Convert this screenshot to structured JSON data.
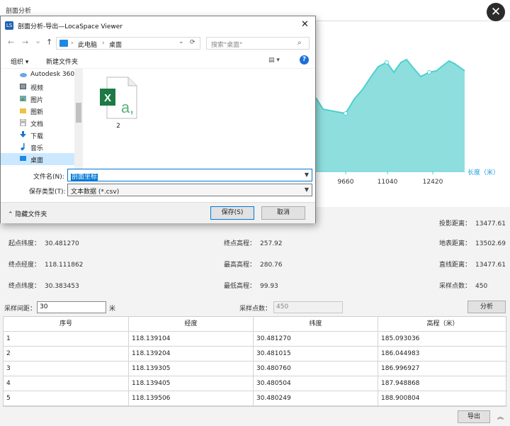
{
  "outer": {
    "title": "剖面分析",
    "close_glyph": "✕"
  },
  "chart_data": {
    "type": "area",
    "x_tick_labels": [
      "9660",
      "11040",
      "12420"
    ],
    "xlabel": "长度（米）",
    "color": "#4fcfcf",
    "fill": "#8fdede"
  },
  "stats": {
    "row1": {
      "proj_dist_label": "投影距离：",
      "proj_dist_value": "13477.61"
    },
    "row2": {
      "start_lat_label": "起点纬度：",
      "start_lat_value": "30.481270",
      "end_elev_label": "终点高程：",
      "end_elev_value": "257.92",
      "surface_dist_label": "地表距离：",
      "surface_dist_value": "13502.69"
    },
    "row3": {
      "end_lon_label": "终点经度：",
      "end_lon_value": "118.111862",
      "max_elev_label": "最高高程：",
      "max_elev_value": "280.76",
      "straight_dist_label": "直线距离：",
      "straight_dist_value": "13477.61"
    },
    "row4": {
      "end_lat_label": "终点纬度：",
      "end_lat_value": "30.383453",
      "min_elev_label": "最低高程：",
      "min_elev_value": "99.93",
      "sample_count_label": "采样点数：",
      "sample_count_value": "450"
    }
  },
  "controls": {
    "interval_label": "采样间距：",
    "interval_value": "30",
    "interval_unit": "米",
    "points_label": "采样点数：",
    "points_value": "450",
    "analyze_label": "分析"
  },
  "table": {
    "headers": [
      "序号",
      "经度",
      "纬度",
      "高程（米）"
    ],
    "rows": [
      [
        "1",
        "118.139104",
        "30.481270",
        "185.093036"
      ],
      [
        "2",
        "118.139204",
        "30.481015",
        "186.044983"
      ],
      [
        "3",
        "118.139305",
        "30.480760",
        "186.996927"
      ],
      [
        "4",
        "118.139405",
        "30.480504",
        "187.948868"
      ],
      [
        "5",
        "118.139506",
        "30.480249",
        "188.900804"
      ]
    ]
  },
  "bottom": {
    "export_label": "导出",
    "collapse_glyph": "︽"
  },
  "dialog": {
    "title": "剖面分析-导出—LocaSpace Viewer",
    "app_icon": "LS",
    "close_glyph": "✕",
    "nav": {
      "back": "←",
      "forward": "→",
      "dropdown": "⌄",
      "up": "↑",
      "refresh": "⟳"
    },
    "address": {
      "sep1": "›",
      "crumb1": "此电脑",
      "sep2": "›",
      "crumb2": "桌面",
      "dropdown": "⌄"
    },
    "search_placeholder": "搜索\"桌面\"",
    "search_icon": "⌕",
    "toolbar": {
      "organize": "组织 ▾",
      "new_folder": "新建文件夹",
      "view": "▤ ▾",
      "help": "?"
    },
    "tree": [
      {
        "label": "Autodesk 360",
        "icon": "cloud-icon"
      },
      {
        "label": "视频",
        "icon": "video-folder-icon"
      },
      {
        "label": "图片",
        "icon": "pictures-folder-icon"
      },
      {
        "label": "图新",
        "icon": "folder-icon"
      },
      {
        "label": "文档",
        "icon": "documents-folder-icon"
      },
      {
        "label": "下载",
        "icon": "downloads-folder-icon"
      },
      {
        "label": "音乐",
        "icon": "music-folder-icon"
      },
      {
        "label": "桌面",
        "icon": "desktop-folder-icon"
      }
    ],
    "file": {
      "name": "2",
      "icon": "excel-csv-file-icon"
    },
    "filename_label": "文件名(N):",
    "filename_value": "剖面坐标",
    "filetype_label": "保存类型(T):",
    "filetype_value": "文本数据 (*.csv)",
    "hide_folders": "隐藏文件夹",
    "save_label": "保存(S)",
    "cancel_label": "取消"
  }
}
